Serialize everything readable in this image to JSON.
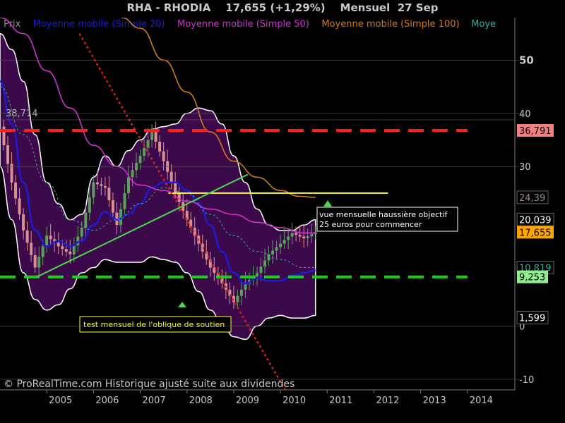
{
  "header": {
    "title": "RHA - RHODIA    17,655 (+1,29%)    Mensuel  27 Sep"
  },
  "legend": [
    {
      "label": "Prix",
      "color": "#9a8d8d"
    },
    {
      "label": "Moyenne mobile (Simple 20)",
      "color": "#1b1bd8"
    },
    {
      "label": "Moyenne mobile (Simple 50)",
      "color": "#cc33cc"
    },
    {
      "label": "Moyenne mobile (Simple 100)",
      "color": "#d07a1a"
    },
    {
      "label": "Moye",
      "color": "#2fb0a0"
    }
  ],
  "footer": {
    "copyright": "© ProRealTime.com Historique ajusté suite aux dividendes"
  },
  "annotations": {
    "left_level": "38,714",
    "box_bottom": "test mensuel de l'oblique de soutien",
    "box_right_line1": "vue mensuelle haussière objectif",
    "box_right_line2": "25 euros pour commencer"
  },
  "colors": {
    "background": "#000000",
    "bollinger_fill": "#3c0a4a",
    "bollinger_edge": "#ffffff",
    "resistance": "#ff1f1f",
    "support": "#19d019",
    "trendline": "#4cd84c",
    "downtrend": "#e02020",
    "target_line": "#ffff33",
    "candle_up": "#5aa05a",
    "candle_down": "#d89090"
  },
  "chart_data": {
    "type": "line",
    "title": "RHA - RHODIA",
    "xlabel": "",
    "ylabel": "",
    "x_ticks": [
      "2005",
      "2006",
      "2007",
      "2008",
      "2009",
      "2010",
      "2011",
      "2012",
      "2013",
      "2014"
    ],
    "y_ticks": [
      {
        "value": 50,
        "label": "50",
        "bold": true
      },
      {
        "value": 40,
        "label": "40"
      },
      {
        "value": 30,
        "label": "30"
      },
      {
        "value": 0,
        "label": "0"
      },
      {
        "value": -10,
        "label": "-10"
      }
    ],
    "ylim": [
      -12,
      58
    ],
    "xlim": [
      2004.0,
      2015.0
    ],
    "grid": false,
    "price_labels": [
      {
        "value": 36.791,
        "label": "36,791",
        "bg": "#f08080",
        "fg": "#000000"
      },
      {
        "value": 24.2,
        "label": "24,39",
        "bg": "#000000",
        "fg": "#9a8d8d",
        "partial": true
      },
      {
        "value": 20.039,
        "label": "20,039",
        "bg": "#000000",
        "fg": "#ffffff"
      },
      {
        "value": 17.655,
        "label": "17,655",
        "bg": "#ffa500",
        "fg": "#000000"
      },
      {
        "value": 11.0,
        "label": "10,819",
        "bg": "#000000",
        "fg": "#2fb0a0",
        "partial": true
      },
      {
        "value": 9.253,
        "label": "9,253",
        "bg": "#90ee90",
        "fg": "#000000"
      },
      {
        "value": 1.599,
        "label": "1,599",
        "bg": "#000000",
        "fg": "#ffffff"
      }
    ],
    "horizontal_lines": [
      {
        "name": "resistance",
        "value": 36.791,
        "x_from": 2004.0,
        "x_to": 2014.0,
        "dashed": true
      },
      {
        "name": "support",
        "value": 9.253,
        "x_from": 2004.0,
        "x_to": 2014.0,
        "dashed": true
      },
      {
        "name": "target",
        "value": 25.0,
        "x_from": 2007.6,
        "x_to": 2012.3,
        "dashed": false
      }
    ],
    "trendlines": [
      {
        "name": "ascending-support",
        "from": [
          2004.8,
          9.3
        ],
        "to": [
          2009.3,
          28.5
        ]
      },
      {
        "name": "descending-downtrend",
        "from": [
          2005.7,
          55.0
        ],
        "to": [
          2010.1,
          -12.0
        ]
      }
    ],
    "price_series": {
      "x": [
        2004.0,
        2004.25,
        2004.5,
        2004.75,
        2005.0,
        2005.25,
        2005.5,
        2005.75,
        2006.0,
        2006.25,
        2006.5,
        2006.75,
        2007.0,
        2007.25,
        2007.5,
        2007.75,
        2008.0,
        2008.25,
        2008.5,
        2008.75,
        2009.0,
        2009.25,
        2009.5,
        2009.75,
        2010.0,
        2010.25,
        2010.5,
        2010.75
      ],
      "values": [
        37.5,
        27.0,
        18.0,
        11.0,
        17.0,
        15.0,
        13.5,
        18.5,
        27.0,
        26.0,
        19.0,
        28.0,
        32.0,
        36.5,
        31.0,
        25.0,
        20.0,
        15.5,
        11.0,
        8.0,
        4.5,
        8.0,
        10.0,
        13.5,
        15.5,
        17.5,
        16.5,
        17.655
      ]
    },
    "series": [
      {
        "name": "Moyenne mobile (Simple 20)",
        "color": "#1b1bd8",
        "x": [
          2004.0,
          2004.25,
          2004.5,
          2004.75,
          2005.0,
          2005.25,
          2005.5,
          2005.75,
          2006.0,
          2006.25,
          2006.5,
          2006.75,
          2007.0,
          2007.25,
          2007.5,
          2007.75,
          2008.0,
          2008.25,
          2008.5,
          2008.75,
          2009.0,
          2009.25,
          2009.5,
          2009.75,
          2010.0,
          2010.25,
          2010.5,
          2010.75
        ],
        "values": [
          46.0,
          38.0,
          27.0,
          18.0,
          15.0,
          16.0,
          15.0,
          16.0,
          19.0,
          21.5,
          20.0,
          21.0,
          23.0,
          26.0,
          27.0,
          27.0,
          25.5,
          23.0,
          19.0,
          14.0,
          10.0,
          8.0,
          9.0,
          8.5,
          8.5,
          9.5,
          10.0,
          10.5
        ]
      },
      {
        "name": "Moyenne mobile (Simple 50)",
        "color": "#cc33cc",
        "x": [
          2004.0,
          2004.5,
          2005.0,
          2005.5,
          2006.0,
          2006.5,
          2007.0,
          2007.5,
          2008.0,
          2008.5,
          2009.0,
          2009.5,
          2010.0,
          2010.5,
          2010.75
        ],
        "values": [
          58.0,
          55.0,
          48.0,
          41.0,
          34.0,
          30.0,
          26.5,
          25.5,
          23.5,
          22.0,
          21.0,
          19.5,
          18.5,
          17.5,
          17.5
        ]
      },
      {
        "name": "Moyenne mobile (Simple 100)",
        "color": "#d07a1a",
        "x": [
          2006.6,
          2007.0,
          2007.5,
          2008.0,
          2008.5,
          2009.0,
          2009.5,
          2010.0,
          2010.4,
          2010.75
        ],
        "values": [
          58.0,
          56.0,
          50.0,
          44.0,
          36.5,
          31.0,
          28.0,
          25.5,
          24.4,
          24.2
        ]
      },
      {
        "name": "Moye",
        "color": "#2fb0a0",
        "x": [
          2004.0,
          2004.5,
          2005.0,
          2005.5,
          2006.0,
          2006.5,
          2007.0,
          2007.5,
          2008.0,
          2008.5,
          2009.0,
          2009.5,
          2010.0,
          2010.5,
          2010.75
        ],
        "values": [
          45.0,
          36.0,
          27.0,
          20.0,
          18.0,
          20.0,
          23.0,
          26.0,
          25.0,
          21.0,
          17.0,
          14.0,
          12.5,
          11.0,
          11.0
        ]
      }
    ],
    "bollinger_upper": {
      "x": [
        2004.0,
        2004.25,
        2004.5,
        2004.75,
        2005.0,
        2005.25,
        2005.5,
        2005.75,
        2006.0,
        2006.25,
        2006.5,
        2006.75,
        2007.0,
        2007.25,
        2007.5,
        2007.75,
        2008.0,
        2008.25,
        2008.5,
        2008.75,
        2009.0,
        2009.25,
        2009.5,
        2009.75,
        2010.0,
        2010.25,
        2010.5,
        2010.75
      ],
      "values": [
        55.0,
        52.0,
        46.0,
        36.0,
        27.0,
        23.0,
        20.0,
        21.0,
        28.0,
        32.0,
        30.0,
        33.0,
        35.0,
        37.0,
        37.5,
        38.0,
        40.0,
        41.0,
        40.5,
        38.0,
        32.0,
        27.0,
        22.0,
        19.0,
        18.0,
        18.0,
        19.0,
        20.0
      ]
    },
    "bollinger_lower": {
      "x": [
        2004.0,
        2004.25,
        2004.5,
        2004.75,
        2005.0,
        2005.25,
        2005.5,
        2005.75,
        2006.0,
        2006.25,
        2006.5,
        2006.75,
        2007.0,
        2007.25,
        2007.5,
        2007.75,
        2008.0,
        2008.25,
        2008.5,
        2008.75,
        2009.0,
        2009.25,
        2009.5,
        2009.75,
        2010.0,
        2010.25,
        2010.5,
        2010.75
      ],
      "values": [
        30.0,
        20.0,
        10.0,
        5.0,
        3.0,
        4.0,
        7.0,
        10.0,
        11.0,
        12.5,
        12.0,
        12.0,
        12.0,
        13.0,
        12.5,
        12.0,
        10.0,
        6.5,
        3.0,
        0.5,
        -2.0,
        -2.5,
        0.0,
        1.5,
        2.0,
        1.5,
        1.5,
        2.0
      ]
    }
  }
}
